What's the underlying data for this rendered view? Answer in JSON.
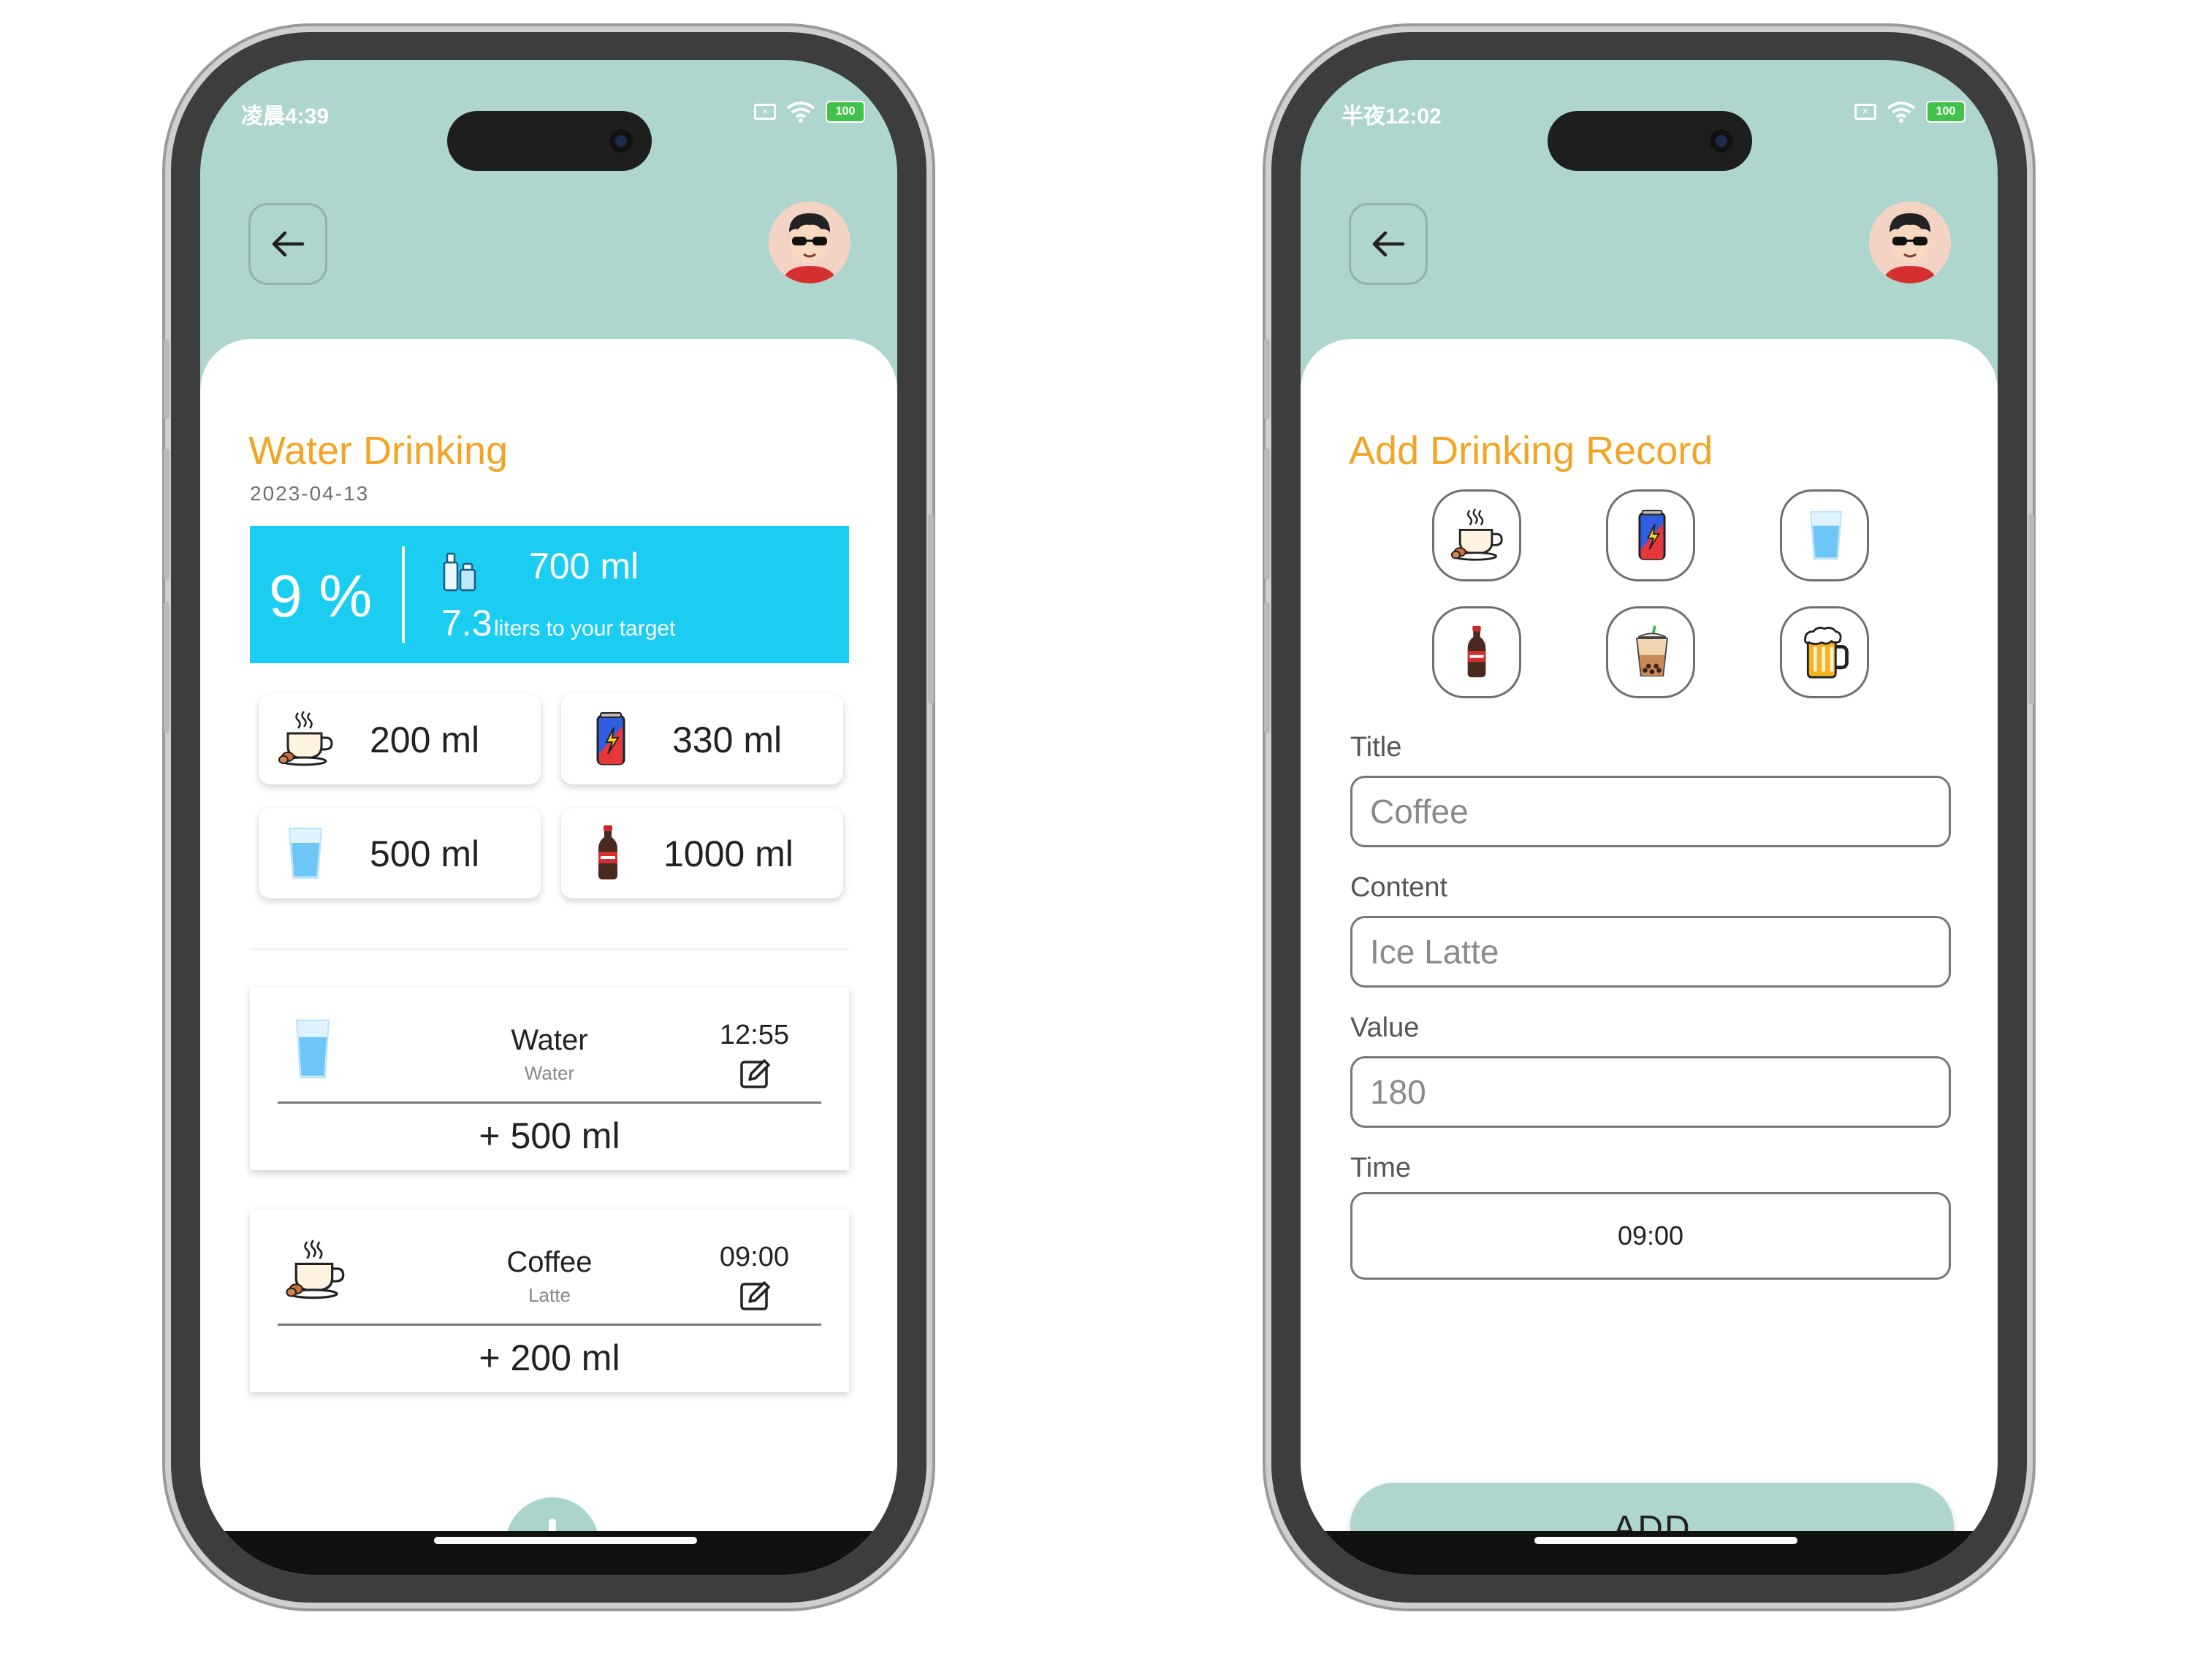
{
  "left": {
    "status_time": "凌晨4:39",
    "battery": "100",
    "title": "Water Drinking",
    "date": "2023-04-13",
    "summary": {
      "percent": "9 %",
      "amount": "700 ml",
      "liters": "7.3",
      "target_text": "liters to your target"
    },
    "quick": [
      {
        "icon": "coffee-cup-icon",
        "value": "200 ml"
      },
      {
        "icon": "energy-can-icon",
        "value": "330 ml"
      },
      {
        "icon": "water-glass-icon",
        "value": "500 ml"
      },
      {
        "icon": "soda-bottle-icon",
        "value": "1000 ml"
      }
    ],
    "records": [
      {
        "icon": "water-glass-icon",
        "title": "Water",
        "content": "Water",
        "time": "12:55",
        "amount": "+ 500 ml"
      },
      {
        "icon": "coffee-cup-icon",
        "title": "Coffee",
        "content": "Latte",
        "time": "09:00",
        "amount": "+ 200 ml"
      }
    ]
  },
  "right": {
    "status_time": "半夜12:02",
    "battery": "100",
    "title": "Add Drinking Record",
    "drink_icons": [
      "coffee-cup-icon",
      "energy-can-icon",
      "water-glass-icon",
      "soda-bottle-icon",
      "bubble-tea-icon",
      "beer-mug-icon"
    ],
    "fields": {
      "title_label": "Title",
      "title_value": "Coffee",
      "content_label": "Content",
      "content_value": "Ice Latte",
      "value_label": "Value",
      "value_value": "180",
      "time_label": "Time",
      "time_value": "09:00"
    },
    "add_label": "ADD"
  },
  "colors": {
    "header_bg": "#afd6ce",
    "accent_title": "#f3a423",
    "summary_bg": "#1ccdf2"
  }
}
